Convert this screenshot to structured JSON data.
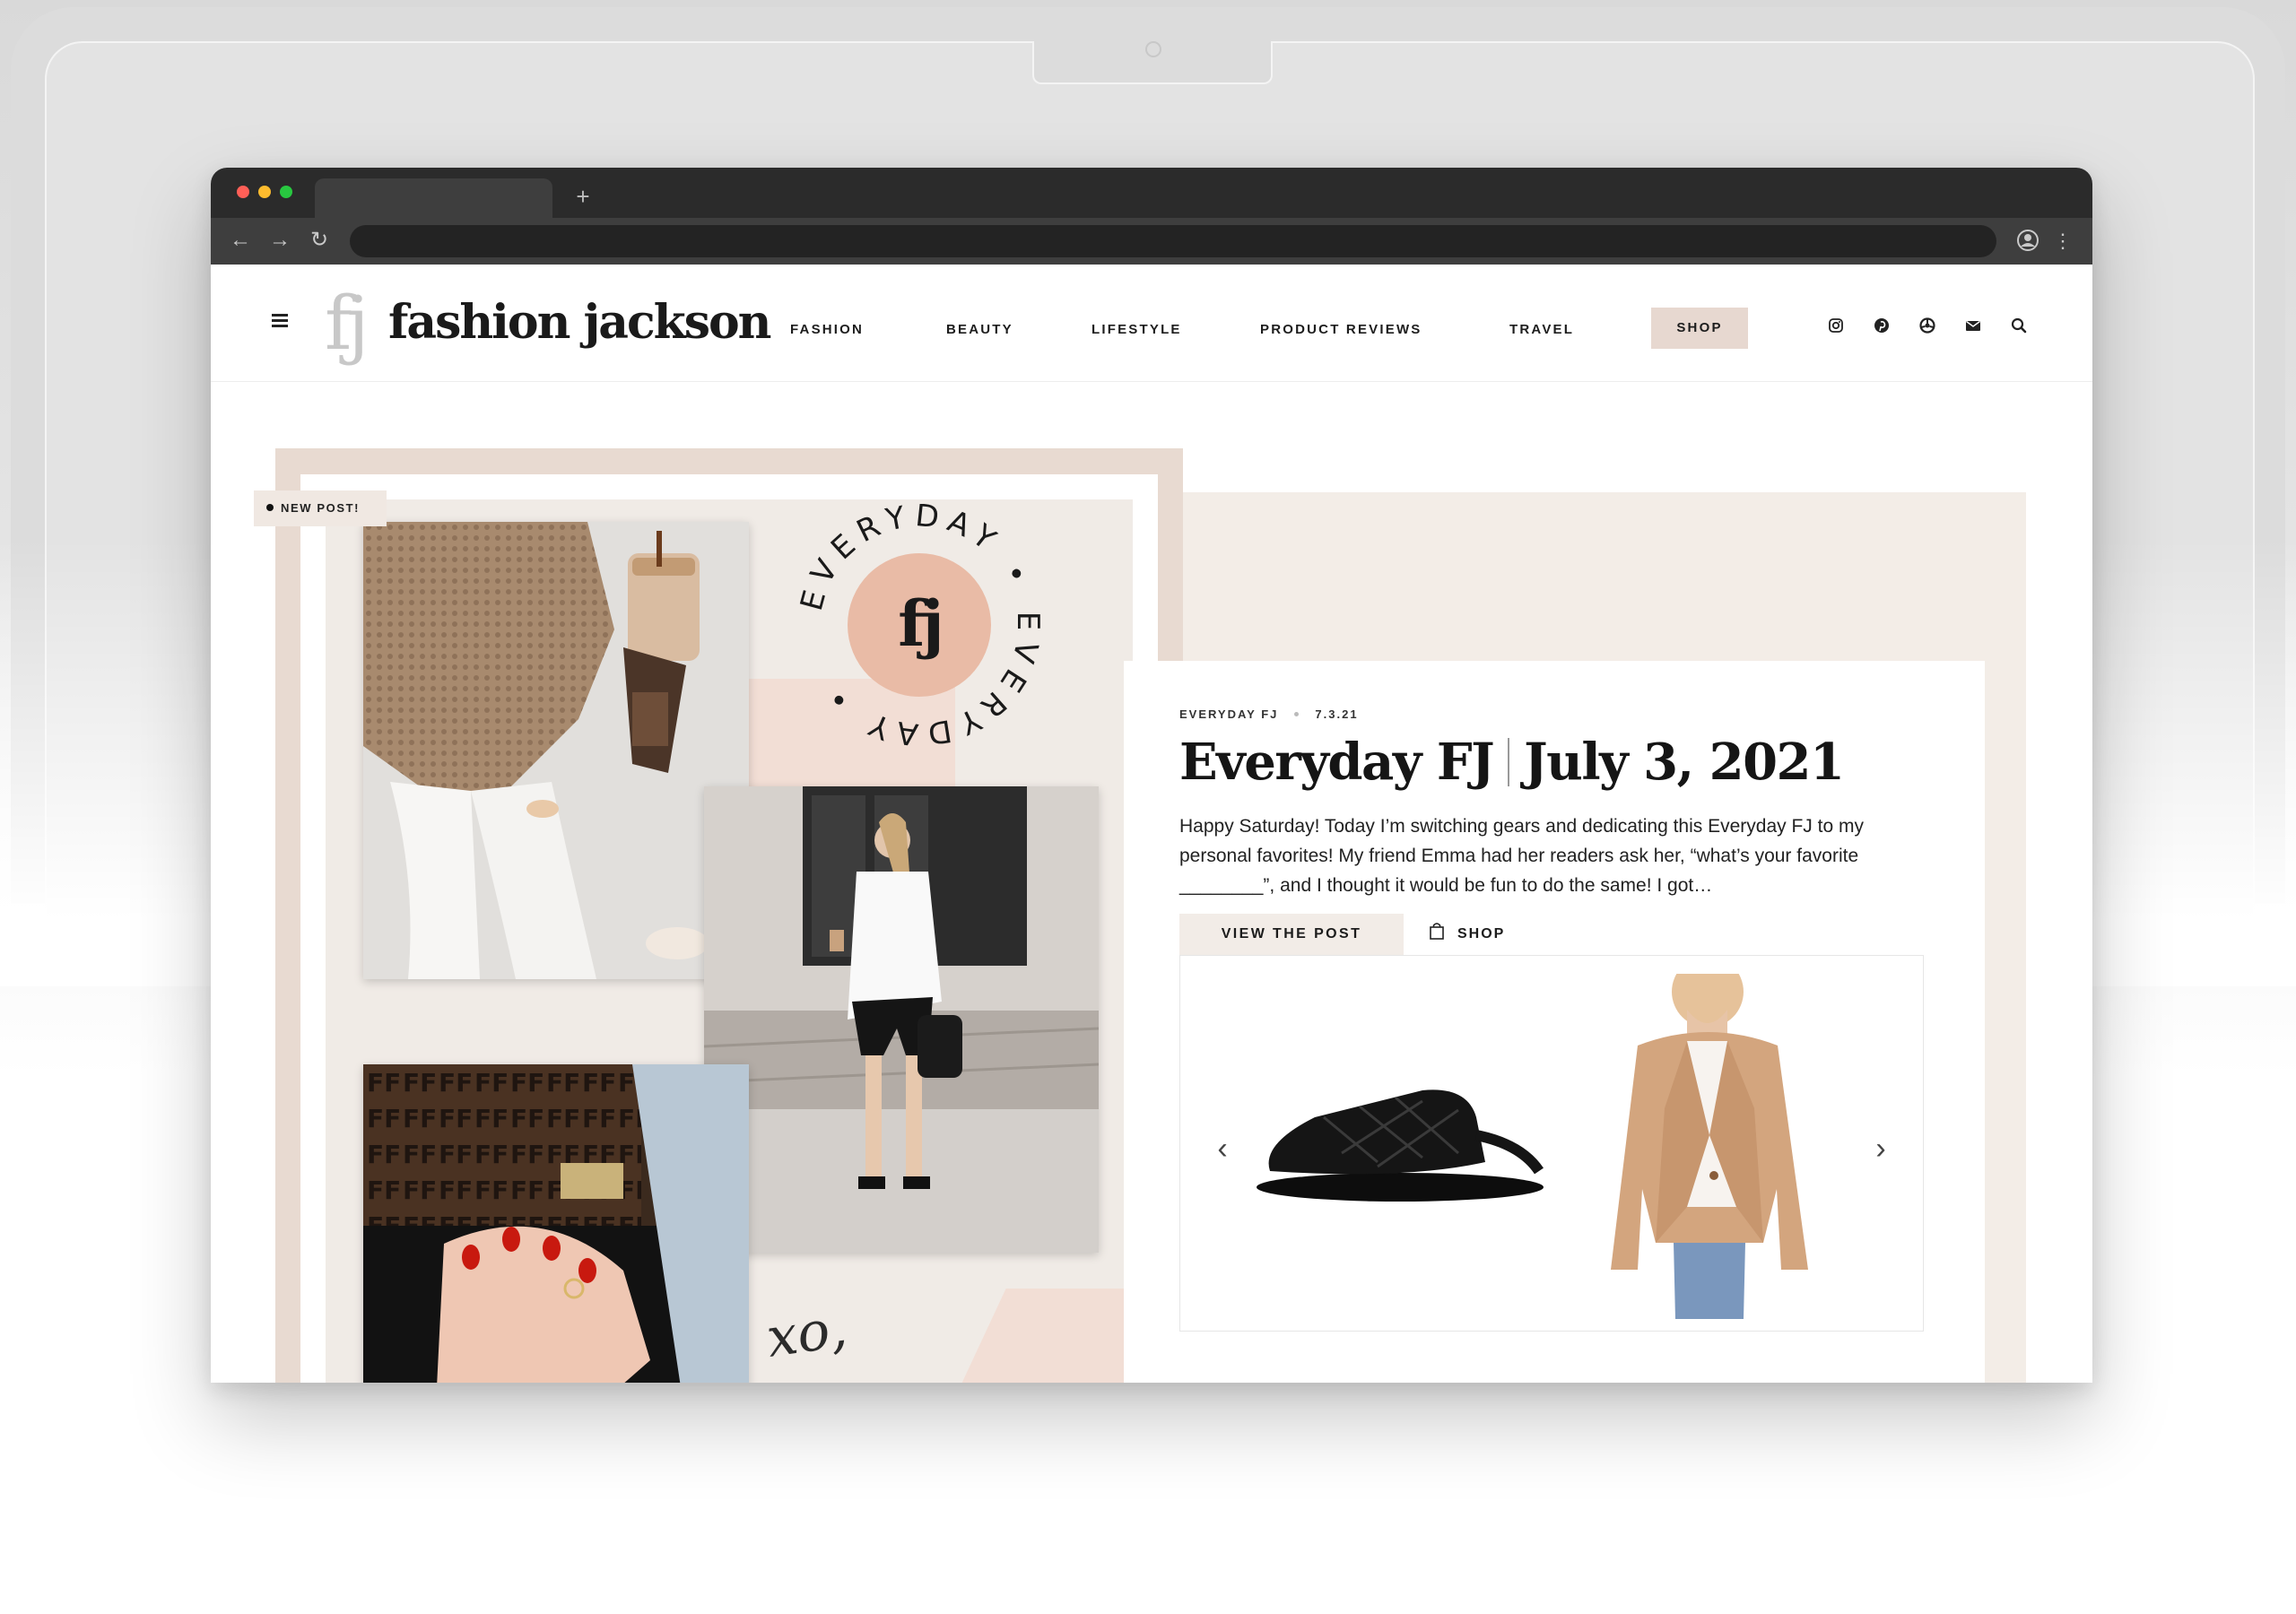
{
  "browser": {
    "traffic_lights": [
      "#ff5f57",
      "#febc2e",
      "#28c840"
    ],
    "new_tab_label": "+",
    "url": ""
  },
  "site": {
    "logo_mark": "fj",
    "logo_text": "fashion jackson",
    "nav": [
      "FASHION",
      "BEAUTY",
      "LIFESTYLE",
      "PRODUCT REVIEWS",
      "TRAVEL"
    ],
    "shop_label": "SHOP",
    "social_icons": [
      "instagram-icon",
      "pinterest-icon",
      "liketoknowit-icon",
      "email-icon",
      "search-icon"
    ],
    "accent_color": "#e7d8d0"
  },
  "hero": {
    "badge": "NEW POST!",
    "seal_text": "EVERYDAY • EVERYDAY •",
    "seal_mark": "fj",
    "signature": "xo,"
  },
  "post": {
    "category": "EVERYDAY FJ",
    "date": "7.3.21",
    "title_left": "Everyday FJ",
    "title_right": "July 3, 2021",
    "excerpt": "Happy Saturday! Today I’m switching gears and dedicating this Everyday FJ to my personal favorites! My friend Emma had her readers ask her, “what’s your favorite ________”, and I thought it would be fun to do the same! I got…",
    "view_button": "VIEW THE POST",
    "shop_button": "SHOP",
    "products": [
      "black-woven-slide-sandal",
      "camel-blazer"
    ],
    "prev_arrow": "‹",
    "next_arrow": "›"
  }
}
